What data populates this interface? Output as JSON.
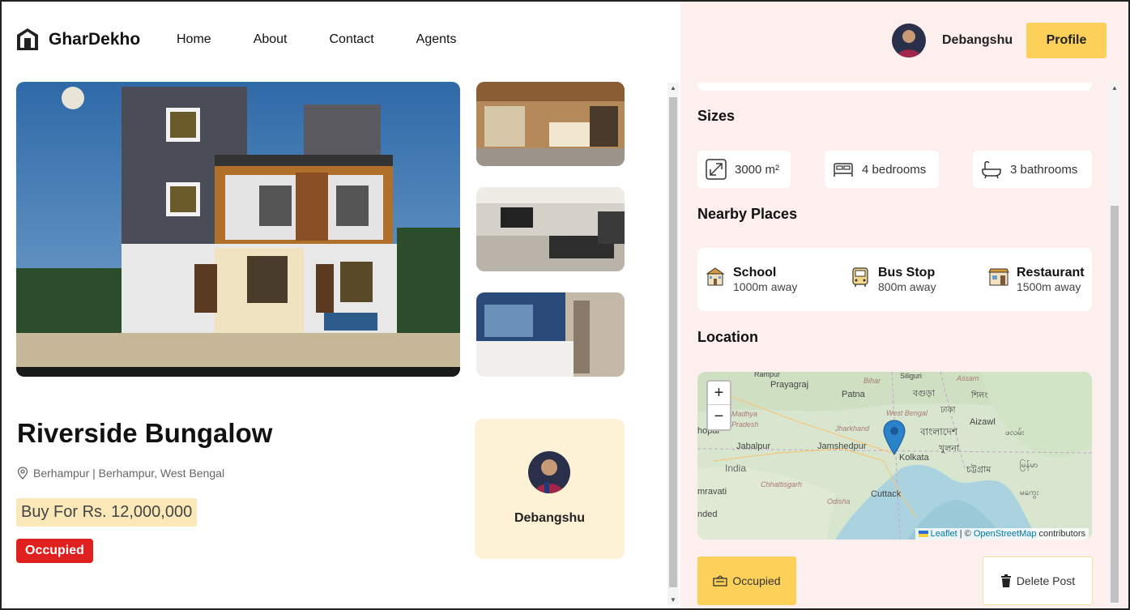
{
  "brand": {
    "name": "GharDekho"
  },
  "nav": {
    "items": [
      "Home",
      "About",
      "Contact",
      "Agents"
    ]
  },
  "user": {
    "name": "Debangshu",
    "profile_label": "Profile"
  },
  "property": {
    "title": "Riverside Bungalow",
    "address": "Berhampur | Berhampur, West Bengal",
    "price": "Buy For Rs. 12,000,000",
    "status_badge": "Occupied",
    "owner_name": "Debangshu"
  },
  "sections": {
    "sizes": "Sizes",
    "nearby": "Nearby Places",
    "location": "Location"
  },
  "sizes": {
    "area": "3000 m²",
    "bedrooms": "4 bedrooms",
    "bathrooms": "3 bathrooms"
  },
  "nearby": [
    {
      "name": "School",
      "distance": "1000m away",
      "icon": "school-icon"
    },
    {
      "name": "Bus Stop",
      "distance": "800m away",
      "icon": "bus-icon"
    },
    {
      "name": "Restaurant",
      "distance": "1500m away",
      "icon": "restaurant-icon"
    }
  ],
  "map": {
    "zoom_in": "+",
    "zoom_out": "−",
    "attribution_leaflet": "Leaflet",
    "attribution_sep": " | © ",
    "attribution_osm": "OpenStreetMap",
    "attribution_rest": " contributors",
    "labels": {
      "prayagraj": "Prayagraj",
      "patna": "Patna",
      "bihar": "Bihar",
      "assam": "Assam",
      "jabalpur": "Jabalpur",
      "jamshedpur": "Jamshedpur",
      "kolkata": "Kolkata",
      "india": "India",
      "amravati": "mravati",
      "cuttack": "Cuttack",
      "aizawl": "Aizawl",
      "west_bengal": "West Bengal",
      "jharkhand": "Jharkhand",
      "chhattisgarh": "Chhattisgarh",
      "odisha": "Odisha",
      "madhya": "Madhya",
      "pradesh": "Pradesh",
      "bhopal": "hopal",
      "nded": "nded",
      "siliguri": "Siliguri",
      "bangladesh": "বাংলাদেশ",
      "dhaka": "ঢাকা",
      "chattogram": "চট্টগ্রাম",
      "meghalaya": "শিলং",
      "myanmar": "မြန်မာ",
      "khulna": "খুলনা",
      "rampur": "Rampur",
      "bogra": "বগুড়া",
      "mizoram": "ဖလမ်း",
      "yangon": "မကွေး"
    }
  },
  "actions": {
    "occupied": "Occupied",
    "delete": "Delete Post"
  }
}
